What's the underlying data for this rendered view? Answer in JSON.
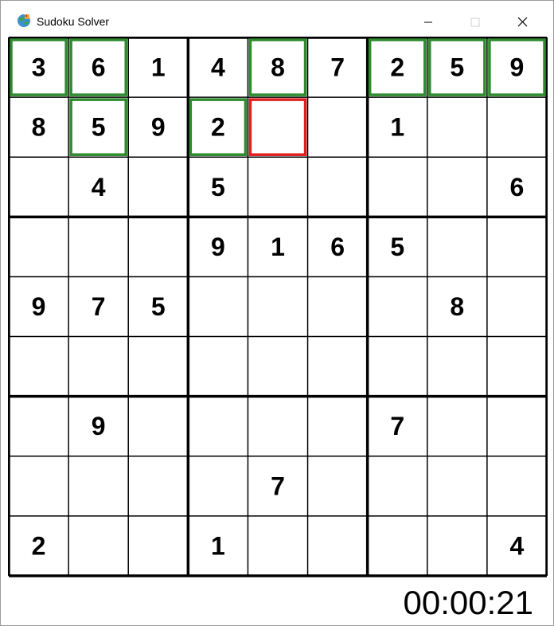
{
  "window": {
    "title": "Sudoku Solver",
    "controls": [
      "minimize-icon",
      "maximize-icon",
      "close-icon"
    ]
  },
  "board": {
    "grid": [
      [
        3,
        6,
        1,
        4,
        8,
        7,
        2,
        5,
        9
      ],
      [
        8,
        5,
        9,
        2,
        0,
        0,
        1,
        0,
        0
      ],
      [
        0,
        4,
        0,
        5,
        0,
        0,
        0,
        0,
        6
      ],
      [
        0,
        0,
        0,
        9,
        1,
        6,
        5,
        0,
        0
      ],
      [
        9,
        7,
        5,
        0,
        0,
        0,
        0,
        8,
        0
      ],
      [
        0,
        0,
        0,
        0,
        0,
        0,
        0,
        0,
        0
      ],
      [
        0,
        9,
        0,
        0,
        0,
        0,
        7,
        0,
        0
      ],
      [
        0,
        0,
        0,
        0,
        7,
        0,
        0,
        0,
        0
      ],
      [
        2,
        0,
        0,
        1,
        0,
        0,
        0,
        0,
        4
      ]
    ],
    "highlighted_green": [
      [
        0,
        0
      ],
      [
        0,
        1
      ],
      [
        0,
        4
      ],
      [
        0,
        6
      ],
      [
        0,
        7
      ],
      [
        0,
        8
      ],
      [
        1,
        1
      ],
      [
        1,
        3
      ]
    ],
    "highlighted_red": [
      [
        1,
        4
      ]
    ],
    "green_color": "#2e8b2e",
    "red_color": "#e02020"
  },
  "status": {
    "timer": "00:00:21"
  }
}
